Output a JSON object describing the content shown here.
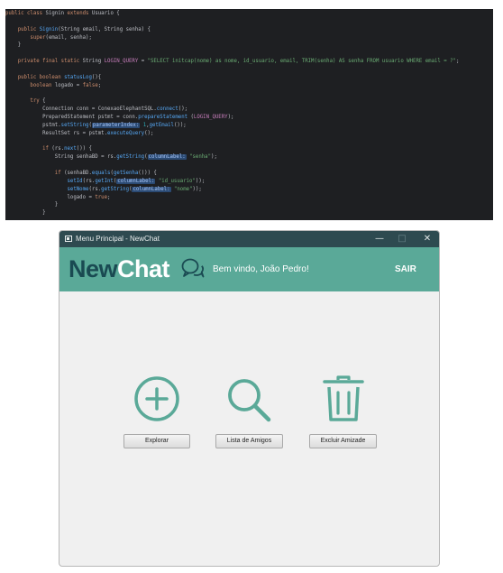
{
  "code": {
    "lines": [
      [
        {
          "c": "kw",
          "t": "public class "
        },
        {
          "c": "",
          "t": "Signin "
        },
        {
          "c": "kw",
          "t": "extends "
        },
        {
          "c": "",
          "t": "Usuario {"
        }
      ],
      [],
      [
        {
          "c": "",
          "t": "    "
        },
        {
          "c": "kw",
          "t": "public "
        },
        {
          "c": "fn",
          "t": "Signin"
        },
        {
          "c": "",
          "t": "(String email, String senha) {"
        }
      ],
      [
        {
          "c": "",
          "t": "        "
        },
        {
          "c": "kw",
          "t": "super"
        },
        {
          "c": "",
          "t": "(email, senha);"
        }
      ],
      [
        {
          "c": "",
          "t": "    }"
        }
      ],
      [],
      [
        {
          "c": "",
          "t": "    "
        },
        {
          "c": "kw",
          "t": "private final static "
        },
        {
          "c": "",
          "t": "String "
        },
        {
          "c": "fld",
          "t": "LOGIN_QUERY"
        },
        {
          "c": "",
          "t": " = "
        },
        {
          "c": "str",
          "t": "\"SELECT initcap(nome) as nome, id_usuario, email, TRIM(senha) AS senha FROM usuario WHERE email = ?\""
        },
        {
          "c": "",
          "t": ";"
        }
      ],
      [],
      [
        {
          "c": "",
          "t": "    "
        },
        {
          "c": "kw",
          "t": "public boolean "
        },
        {
          "c": "fn",
          "t": "statusLog"
        },
        {
          "c": "",
          "t": "(){"
        }
      ],
      [
        {
          "c": "",
          "t": "        "
        },
        {
          "c": "kw",
          "t": "boolean "
        },
        {
          "c": "",
          "t": "logado = "
        },
        {
          "c": "kw",
          "t": "false"
        },
        {
          "c": "",
          "t": ";"
        }
      ],
      [],
      [
        {
          "c": "",
          "t": "        "
        },
        {
          "c": "kw",
          "t": "try "
        },
        {
          "c": "",
          "t": "{"
        }
      ],
      [
        {
          "c": "",
          "t": "            Connection conn = ConexaoElephantSQL."
        },
        {
          "c": "fn",
          "t": "connect"
        },
        {
          "c": "",
          "t": "();"
        }
      ],
      [
        {
          "c": "",
          "t": "            PreparedStatement pstmt = conn."
        },
        {
          "c": "fn",
          "t": "prepareStatement"
        },
        {
          "c": "",
          "t": " ("
        },
        {
          "c": "fld",
          "t": "LOGIN_QUERY"
        },
        {
          "c": "",
          "t": ");"
        }
      ],
      [
        {
          "c": "",
          "t": "            pstmt."
        },
        {
          "c": "fn",
          "t": "setString"
        },
        {
          "c": "",
          "t": "("
        },
        {
          "c": "hint",
          "t": "parameterIndex:"
        },
        {
          "c": "num",
          "t": " 1"
        },
        {
          "c": "",
          "t": ","
        },
        {
          "c": "fn",
          "t": "getEmail"
        },
        {
          "c": "",
          "t": "());"
        }
      ],
      [
        {
          "c": "",
          "t": "            ResultSet rs = pstmt."
        },
        {
          "c": "fn",
          "t": "executeQuery"
        },
        {
          "c": "",
          "t": "();"
        }
      ],
      [],
      [
        {
          "c": "",
          "t": "            "
        },
        {
          "c": "kw",
          "t": "if "
        },
        {
          "c": "",
          "t": "(rs."
        },
        {
          "c": "fn",
          "t": "next"
        },
        {
          "c": "",
          "t": "()) {"
        }
      ],
      [
        {
          "c": "",
          "t": "                String senhaBD = rs."
        },
        {
          "c": "fn",
          "t": "getString"
        },
        {
          "c": "",
          "t": "("
        },
        {
          "c": "hint",
          "t": "columnLabel:"
        },
        {
          "c": "str",
          "t": " \"senha\""
        },
        {
          "c": "",
          "t": ");"
        }
      ],
      [],
      [
        {
          "c": "",
          "t": "                "
        },
        {
          "c": "kw",
          "t": "if "
        },
        {
          "c": "",
          "t": "(senhaBD."
        },
        {
          "c": "fn",
          "t": "equals"
        },
        {
          "c": "",
          "t": "("
        },
        {
          "c": "fn",
          "t": "getSenha"
        },
        {
          "c": "",
          "t": "())) {"
        }
      ],
      [
        {
          "c": "",
          "t": "                    "
        },
        {
          "c": "fn",
          "t": "setId"
        },
        {
          "c": "",
          "t": "(rs."
        },
        {
          "c": "fn",
          "t": "getInt"
        },
        {
          "c": "",
          "t": "("
        },
        {
          "c": "hint",
          "t": "columnLabel:"
        },
        {
          "c": "str",
          "t": " \"id_usuario\""
        },
        {
          "c": "",
          "t": "));"
        }
      ],
      [
        {
          "c": "",
          "t": "                    "
        },
        {
          "c": "fn",
          "t": "setNome"
        },
        {
          "c": "",
          "t": "(rs."
        },
        {
          "c": "fn",
          "t": "getString"
        },
        {
          "c": "",
          "t": "("
        },
        {
          "c": "hint",
          "t": "columnLabel:"
        },
        {
          "c": "str",
          "t": " \"nome\""
        },
        {
          "c": "",
          "t": "));"
        }
      ],
      [
        {
          "c": "",
          "t": "                    logado = "
        },
        {
          "c": "kw",
          "t": "true"
        },
        {
          "c": "",
          "t": ";"
        }
      ],
      [
        {
          "c": "",
          "t": "                }"
        }
      ],
      [
        {
          "c": "",
          "t": "            }"
        }
      ]
    ]
  },
  "window": {
    "title": "Menu Principal - NewChat",
    "controls": {
      "minimize": "—",
      "maximize": "□",
      "close": "✕"
    }
  },
  "header": {
    "logo_new": "New",
    "logo_chat": "Chat",
    "logo_icon": "chat-bubbles-icon",
    "welcome": "Bem vindo, João Pedro!",
    "logout_label": "SAIR"
  },
  "actions": [
    {
      "icon": "plus-circle-icon",
      "label": "Explorar"
    },
    {
      "icon": "search-icon",
      "label": "Lista de Amigos"
    },
    {
      "icon": "trash-icon",
      "label": "Excluir Amizade"
    }
  ],
  "colors": {
    "editor_bg": "#1e1f22",
    "titlebar": "#2e4a50",
    "header": "#5aa998",
    "logo_dark": "#1a4a52",
    "icon": "#5aa998",
    "window_bg": "#f0f0f0"
  }
}
